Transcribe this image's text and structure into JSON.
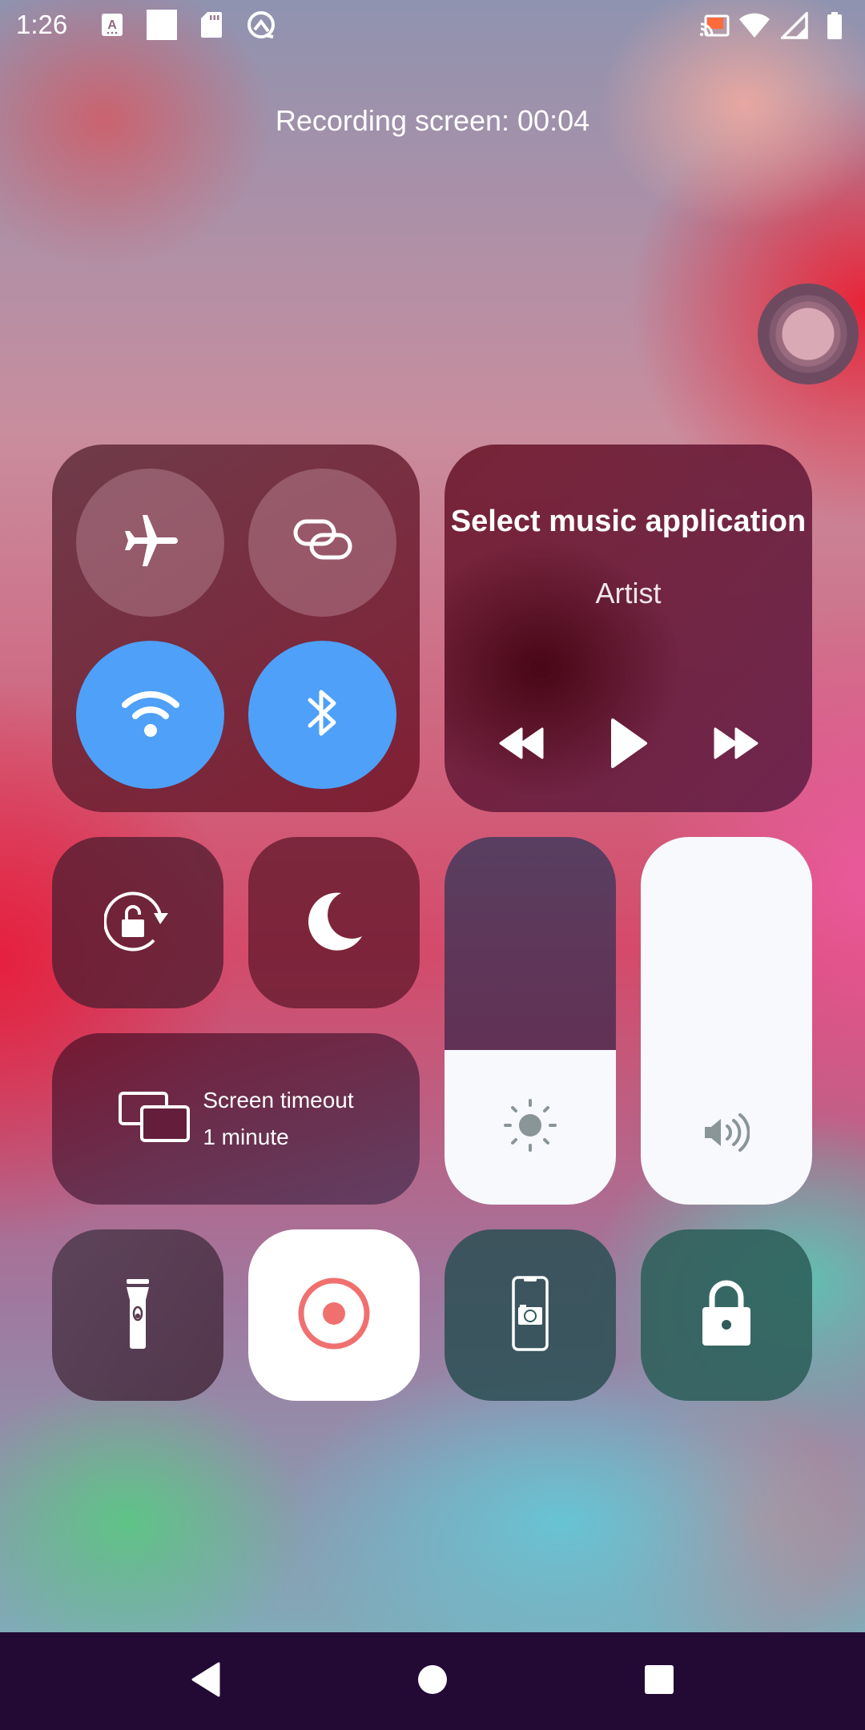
{
  "status_bar": {
    "time": "1:26",
    "left_icons": [
      "font-accessibility-icon",
      "blank-square-icon",
      "sd-card-icon",
      "q-logo-icon"
    ],
    "right_icons": [
      "cast-icon",
      "wifi-icon",
      "cellular-signal-icon",
      "battery-icon"
    ]
  },
  "recording": {
    "label": "Recording screen: 00:04"
  },
  "connectivity": {
    "airplane": {
      "state": "off",
      "icon": "airplane-icon"
    },
    "hotspot": {
      "state": "off",
      "icon": "link-icon"
    },
    "wifi": {
      "state": "on",
      "icon": "wifi-icon"
    },
    "bluetooth": {
      "state": "on",
      "icon": "bluetooth-icon"
    },
    "active_color": "#4ea0f8"
  },
  "media": {
    "title": "Select music application",
    "artist": "Artist",
    "controls": [
      "rewind",
      "play",
      "fast-forward"
    ]
  },
  "toggles": {
    "rotation_lock": {
      "icon": "rotation-lock-icon"
    },
    "do_not_disturb": {
      "icon": "moon-icon"
    }
  },
  "screen_timeout": {
    "label": "Screen timeout",
    "value": "1 minute"
  },
  "sliders": {
    "brightness": {
      "level": 0.42,
      "icon": "sun-icon"
    },
    "volume": {
      "level": 1.0,
      "icon": "speaker-icon"
    }
  },
  "bottom_row": [
    {
      "name": "flashlight",
      "icon": "flashlight-icon",
      "active": false
    },
    {
      "name": "screen-record",
      "icon": "record-icon",
      "active": true,
      "accent": "#f07070"
    },
    {
      "name": "screenshot",
      "icon": "phone-camera-icon",
      "active": false
    },
    {
      "name": "screen-lock",
      "icon": "padlock-icon",
      "active": false
    }
  ],
  "nav": [
    "back",
    "home",
    "recents"
  ]
}
